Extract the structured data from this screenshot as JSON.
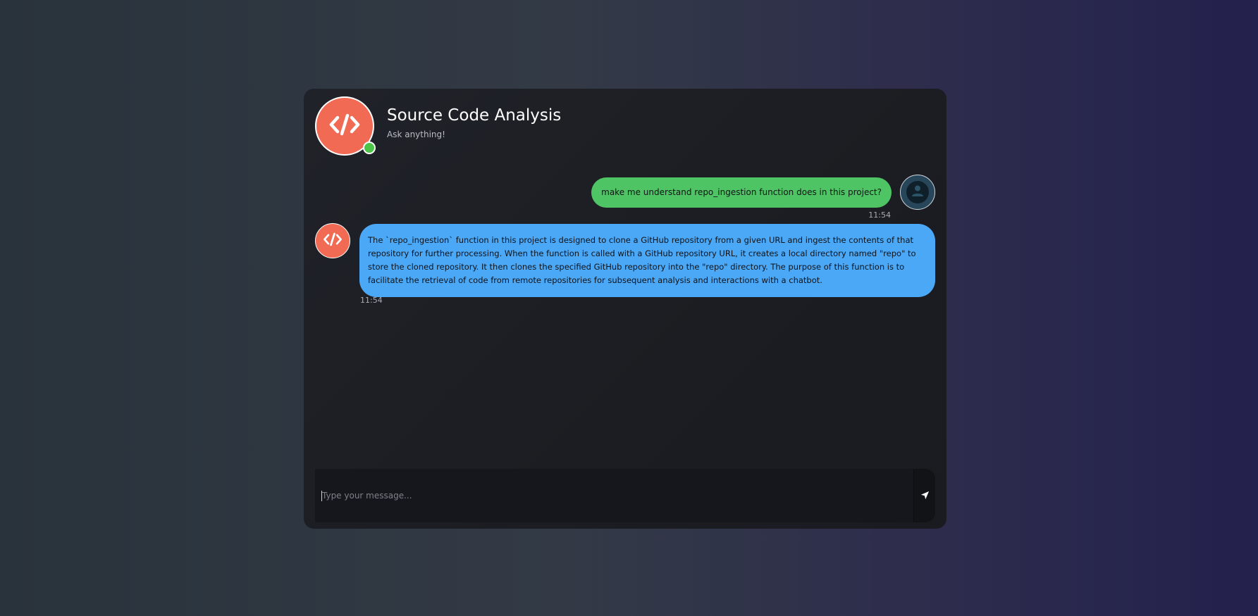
{
  "header": {
    "title": "Source Code Analysis",
    "subtitle": "Ask anything!",
    "brand_icon": "code-icon",
    "status": "online"
  },
  "messages": [
    {
      "role": "user",
      "text": "make me understand repo_ingestion function does in this project?",
      "time": "11:54",
      "avatar_icon": "user-icon"
    },
    {
      "role": "bot",
      "text": "The `repo_ingestion` function in this project is designed to clone a GitHub repository from a given URL and ingest the contents of that repository for further processing. When the function is called with a GitHub repository URL, it creates a local directory named \"repo\" to store the cloned repository. It then clones the specified GitHub repository into the \"repo\" directory. The purpose of this function is to facilitate the retrieval of code from remote repositories for subsequent analysis and interactions with a chatbot.",
      "time": "11:54",
      "avatar_icon": "code-icon"
    }
  ],
  "composer": {
    "placeholder": "Type your message...",
    "value": "",
    "send_icon": "send-icon"
  },
  "colors": {
    "brand": "#f06a54",
    "online": "#4cc445",
    "user_bubble": "#4ec465",
    "bot_bubble": "#4ba8f7",
    "card": "#1e2026"
  }
}
